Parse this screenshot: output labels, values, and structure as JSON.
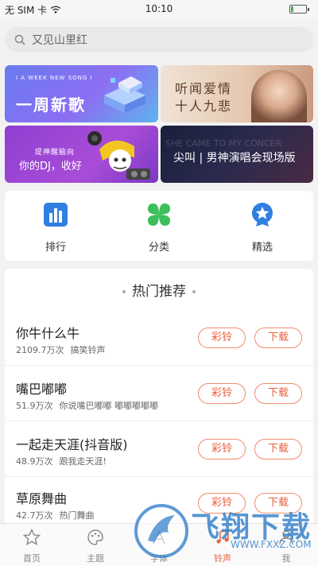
{
  "status": {
    "carrier": "无 SIM 卡",
    "time": "10:10"
  },
  "search": {
    "placeholder": "又见山里红"
  },
  "banners": {
    "weekly": {
      "small": "I A WEEK NEW SONG I",
      "big": "一周新歌"
    },
    "love": {
      "line1": "听闻爱情",
      "line2": "十人九悲"
    },
    "dj": {
      "line1": "提神醒脑向",
      "line2": "你的DJ，收好"
    },
    "concert": {
      "bg_text": "SHE CAME TO MY CONCER",
      "title": "尖叫 | 男神演唱会现场版"
    }
  },
  "quick_links": [
    {
      "label": "排行",
      "icon": "ranking-icon"
    },
    {
      "label": "分类",
      "icon": "category-icon"
    },
    {
      "label": "精选",
      "icon": "featured-star-icon"
    }
  ],
  "recommend": {
    "title": "热门推荐",
    "colorring_label": "彩铃",
    "download_label": "下载",
    "items": [
      {
        "title": "你牛什么牛",
        "count": "2109.7万次",
        "desc": "搞笑铃声"
      },
      {
        "title": "嘴巴嘟嘟",
        "count": "51.9万次",
        "desc": "你说嘴巴嘟嘟 嘟嘟嘟嘟嘟"
      },
      {
        "title": "一起走天涯(抖音版)",
        "count": "48.9万次",
        "desc": "跟我走天涯!"
      },
      {
        "title": "草原舞曲",
        "count": "42.7万次",
        "desc": "热门舞曲"
      }
    ]
  },
  "tabs": [
    {
      "label": "首页",
      "icon": "star-icon"
    },
    {
      "label": "主题",
      "icon": "palette-icon"
    },
    {
      "label": "字体",
      "icon": "font-icon"
    },
    {
      "label": "铃声",
      "icon": "music-icon",
      "active": true
    },
    {
      "label": "我",
      "icon": "user-icon"
    }
  ],
  "watermark": {
    "text": "飞翔下载",
    "url": "WWW.FXXZ.COM"
  },
  "colors": {
    "accent": "#e9603e",
    "pill_border": "#f08c6e",
    "rank_blue": "#2f7fe0",
    "category_green": "#3cbf5a"
  }
}
